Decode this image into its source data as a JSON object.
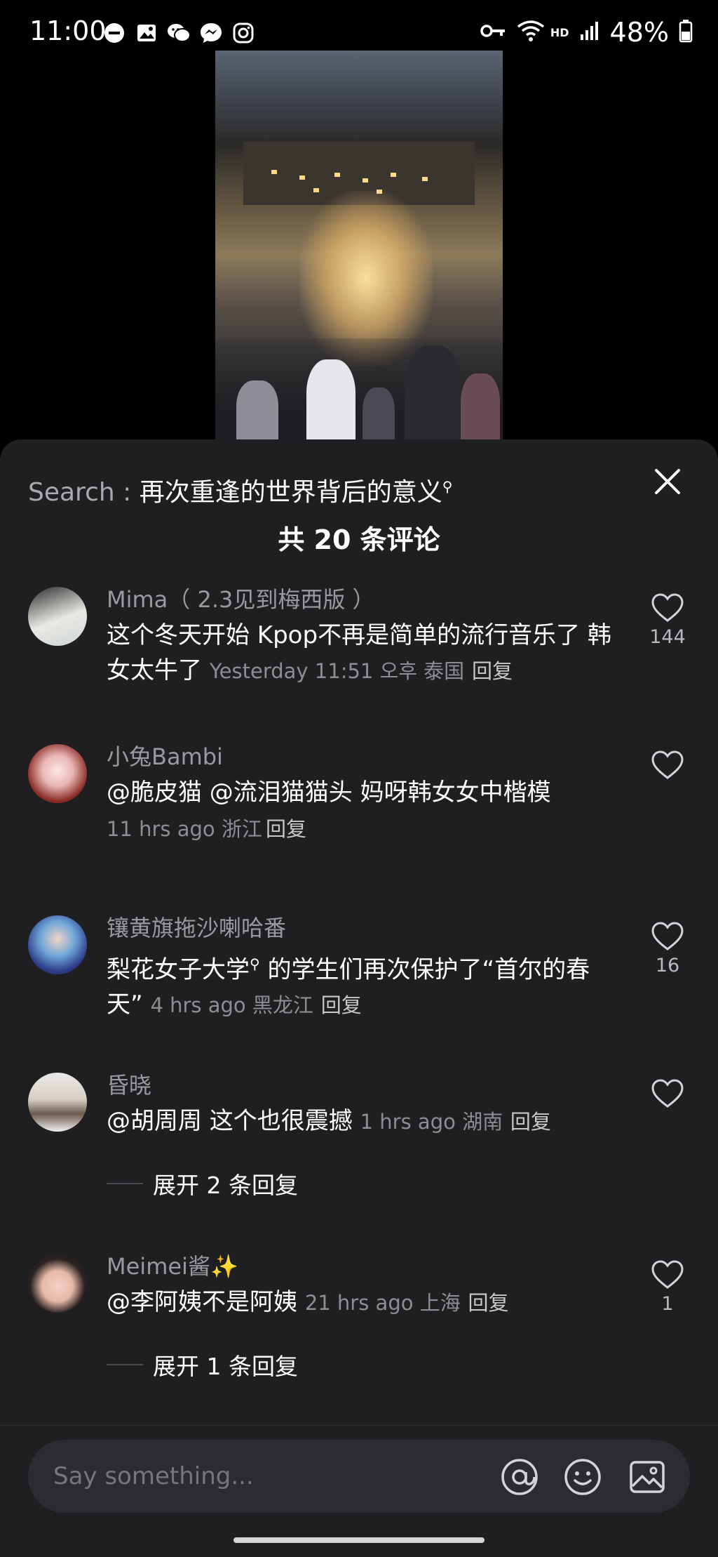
{
  "status_bar": {
    "time": "11:00",
    "battery": "48%",
    "network_badge": "HD",
    "left_icons": [
      "minus-circle-icon",
      "image-icon",
      "wechat-icon",
      "messenger-icon",
      "instagram-icon"
    ],
    "right_icons": [
      "key-icon",
      "wifi-icon",
      "signal-icon",
      "battery-icon"
    ]
  },
  "sheet": {
    "search_label": "Search :",
    "search_query": "再次重逢的世界背后的意义",
    "search_suffix_icon": "search-icon",
    "comment_count_title": "共 20 条评论",
    "close_icon": "close-icon"
  },
  "comments": [
    {
      "name": "Mima（ 2.3见到梅西版 ）",
      "text": "这个冬天开始 Kpop不再是简单的流行音乐了 韩女太牛了",
      "meta": "Yesterday 11:51 오후 泰国",
      "reply": "回复",
      "likes": "144"
    },
    {
      "name": "小兔Bambi",
      "text": "@脆皮猫  @流泪猫猫头  妈呀韩女女中楷模",
      "meta": "11 hrs ago 浙江",
      "reply": "回复",
      "likes": ""
    },
    {
      "name": "镶黄旗拖沙喇哈番",
      "text_before": "梨花女子大学",
      "text_after": " 的学生们再次保护了“首尔的春天”",
      "meta": "4 hrs ago 黑龙江",
      "reply": "回复",
      "likes": "16"
    },
    {
      "name": "昏晓",
      "text": "@胡周周  这个也很震撼",
      "meta": "1 hrs ago 湖南",
      "reply": "回复",
      "likes": "",
      "expand": "展开 2 条回复"
    },
    {
      "name": "Meimei酱✨",
      "text": "@李阿姨不是阿姨",
      "meta": "21 hrs ago 上海",
      "reply": "回复",
      "likes": "1",
      "expand": "展开 1 条回复"
    }
  ],
  "input": {
    "placeholder": "Say something...",
    "icons": [
      "at-icon",
      "emoji-icon",
      "image-icon"
    ]
  },
  "colors": {
    "sheet_bg": "#1f1f22",
    "secondary_text": "#9a9a9e",
    "input_bg": "#2c2c30"
  }
}
